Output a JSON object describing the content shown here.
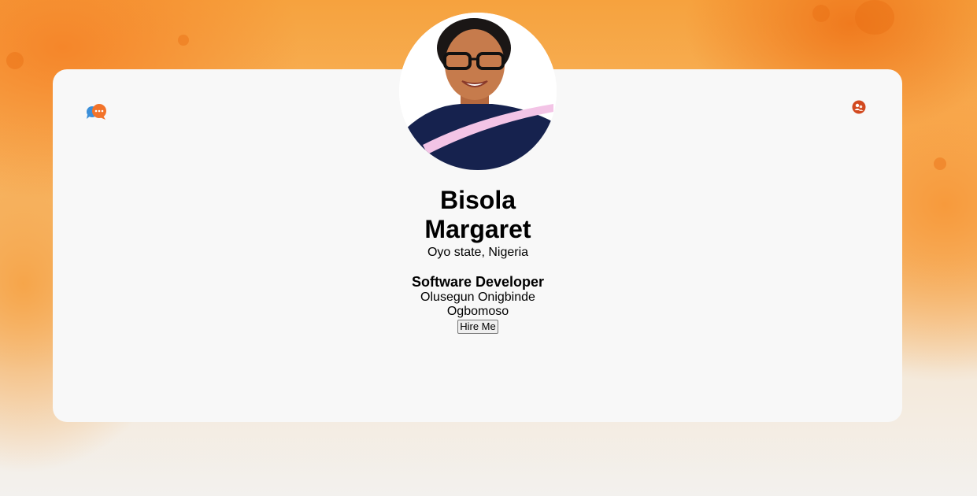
{
  "profile": {
    "name": "Bisola Margaret",
    "location": "Oyo state, Nigeria",
    "job_title": "Software Developer",
    "school": "Olusegun Onigbinde",
    "city": "Ogbomoso",
    "hire_button_label": "Hire Me"
  },
  "icons": {
    "left": "chat-bubbles-icon",
    "right": "people-icon"
  },
  "colors": {
    "accent": "#f07a1e",
    "card": "#f8f8f8",
    "chat_blue": "#3b8fd9",
    "chat_orange": "#f2732a",
    "people_badge": "#d2491f"
  }
}
